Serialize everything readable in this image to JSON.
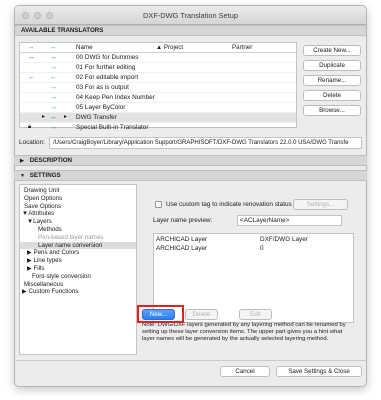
{
  "window": {
    "title": "DXF-DWG Translation Setup"
  },
  "translators": {
    "header": "AVAILABLE TRANSLATORS",
    "columns": {
      "name": "Name",
      "project": "▲ Project",
      "partner": "Partner"
    },
    "rows": [
      {
        "name": "00 DWG for Dummies"
      },
      {
        "name": "01 For further editing"
      },
      {
        "name": "02 For editable import"
      },
      {
        "name": "03 For as is output"
      },
      {
        "name": "04 Keep Pen Index Number"
      },
      {
        "name": "05 Layer ByColor"
      },
      {
        "name": "DWG Transfer"
      },
      {
        "name": "Special Built-in Translator"
      }
    ],
    "buttons": {
      "create": "Create New...",
      "duplicate": "Duplicate",
      "rename": "Rename...",
      "delete": "Delete",
      "browse": "Browse..."
    }
  },
  "location": {
    "label": "Location:",
    "path": "/Users/CraigBoyer/Library/Application Support/GRAPHISOFT/DXF-DWG Translators 22.0.0 USA/DWG Transfe"
  },
  "description": {
    "header": "DESCRIPTION"
  },
  "settings": {
    "header": "SETTINGS",
    "tree": [
      "Drawing Unit",
      "Open Options",
      "Save Options",
      "▼Attributes",
      "▼Layers",
      "Methods",
      "Pen-based layer names",
      "Layer name conversion",
      "▶ Pens and Colors",
      "▶ Line types",
      "▶ Fills",
      "Font-style conversion",
      "Miscellaneous",
      "▶ Custom Functions"
    ],
    "checkbox_label": "Use custom tag to indicate renovation status",
    "settings_button": "Settings...",
    "preview_label": "Layer name preview:",
    "preview_value": "<ACLayerName>",
    "layer_table": {
      "col1": "ARCHICAD Layer",
      "col2": "DXF/DWG Layer",
      "rows": [
        {
          "c1": "ARCHICAD Layer",
          "c2": "0"
        }
      ]
    },
    "buttons": {
      "new": "New...",
      "delete": "Delete",
      "edit": "Edit"
    },
    "note": "Note: DWG/DXF layers generated by any layering method can be renamed by setting up these layer conversion items. The upper part gives you a hint what layer names will be generated by the actually selected layering method."
  },
  "footer": {
    "cancel": "Cancel",
    "save": "Save Settings & Close"
  }
}
